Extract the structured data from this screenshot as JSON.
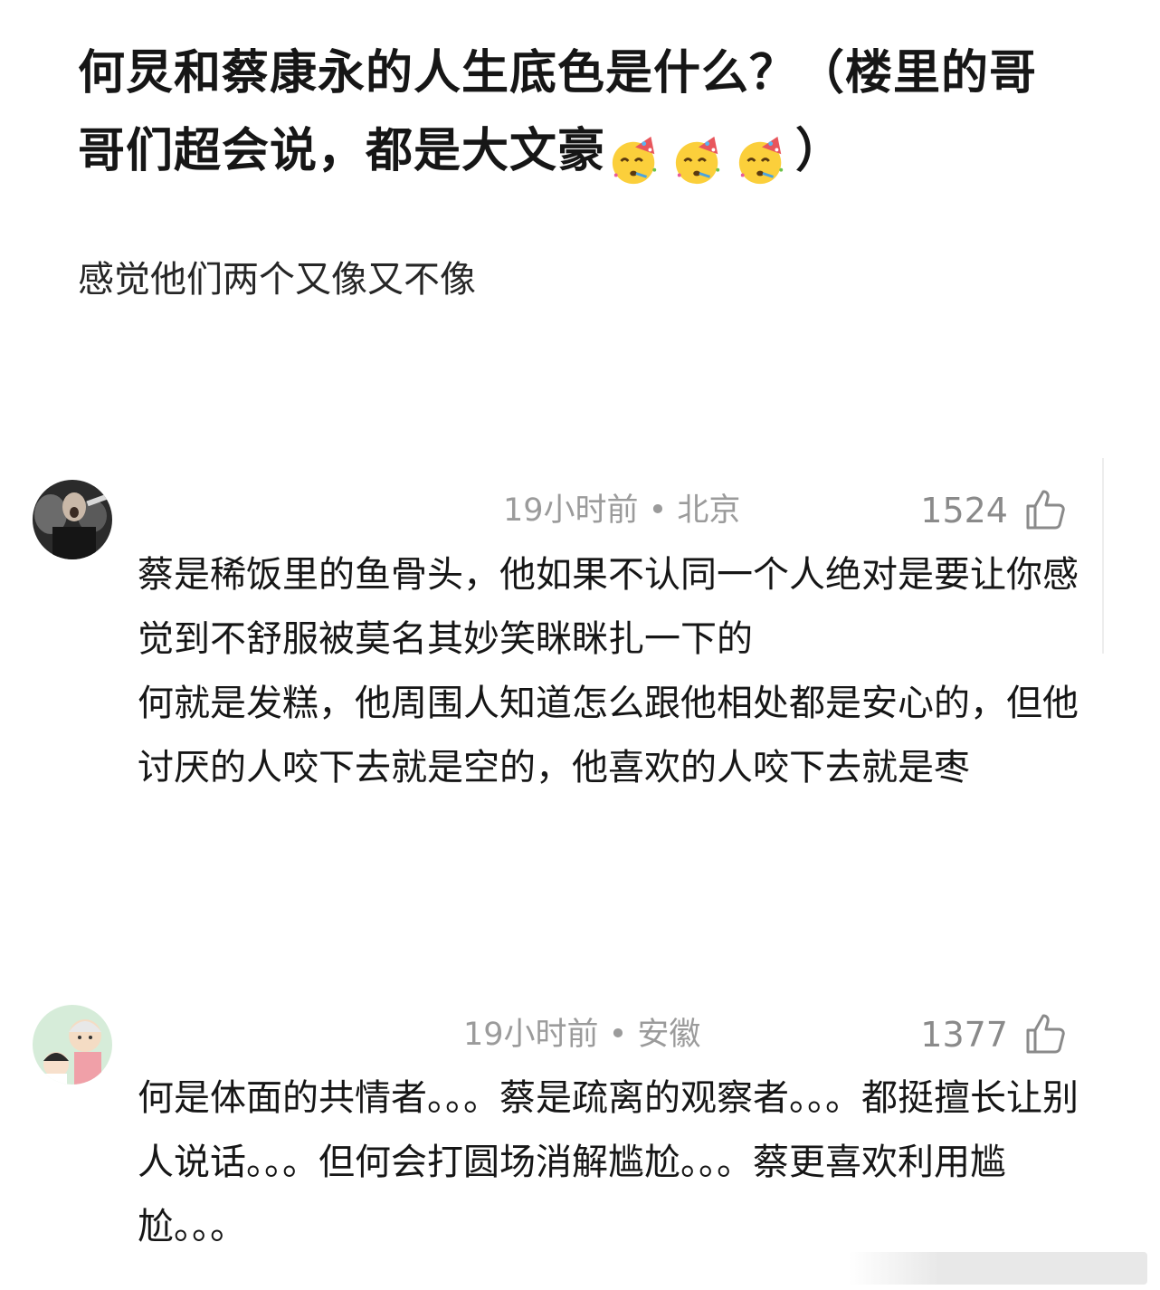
{
  "post": {
    "title": "何炅和蔡康永的人生底色是什么？（楼里的哥哥们超会说，都是大文豪",
    "title_end": "）",
    "title_emoji": [
      "partying-face-icon",
      "partying-face-icon",
      "partying-face-icon"
    ],
    "body": "感觉他们两个又像又不像"
  },
  "comments": [
    {
      "avatar": "user-avatar-photo",
      "time_location": "19小时前 • 北京",
      "likes": "1524",
      "like_icon": "thumbs-up-icon",
      "text": "蔡是稀饭里的鱼骨头，他如果不认同一个人绝对是要让你感觉到不舒服被莫名其妙笑眯眯扎一下的\n何就是发糕，他周围人知道怎么跟他相处都是安心的，但他讨厌的人咬下去就是空的，他喜欢的人咬下去就是枣"
    },
    {
      "avatar": "user-avatar-cartoon",
      "time_location": "19小时前 • 安徽",
      "likes": "1377",
      "like_icon": "thumbs-up-icon",
      "text": "何是体面的共情者。。。蔡是疏离的观察者。。。都挺擅长让别人说话。。。但何会打圆场消解尴尬。。。蔡更喜欢利用尴尬。。。"
    }
  ],
  "colors": {
    "title": "#161616",
    "meta": "#9b9b9b",
    "likes": "#8a8a8a",
    "text": "#161616"
  }
}
